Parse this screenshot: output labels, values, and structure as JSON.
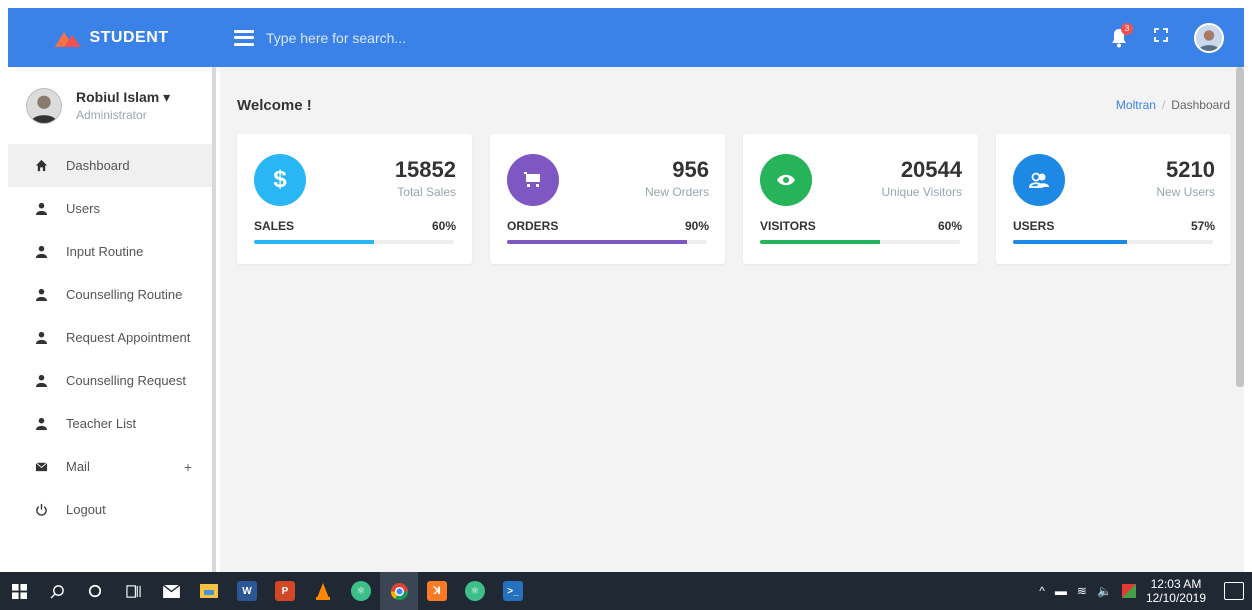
{
  "brand": {
    "name": "STUDENT"
  },
  "search": {
    "placeholder": "Type here for search..."
  },
  "topbar": {
    "notification_count": "3"
  },
  "user": {
    "name": "Robiul Islam",
    "caret": "▾",
    "role": "Administrator"
  },
  "sidebar": {
    "items": [
      {
        "label": "Dashboard",
        "icon": "home-icon"
      },
      {
        "label": "Users",
        "icon": "user-icon"
      },
      {
        "label": "Input Routine",
        "icon": "user-icon"
      },
      {
        "label": "Counselling Routine",
        "icon": "user-icon"
      },
      {
        "label": "Request Appointment",
        "icon": "user-icon"
      },
      {
        "label": "Counselling Request",
        "icon": "user-icon"
      },
      {
        "label": "Teacher List",
        "icon": "user-icon"
      },
      {
        "label": "Mail",
        "icon": "envelope-icon",
        "extra": "+"
      },
      {
        "label": "Logout",
        "icon": "power-icon"
      }
    ]
  },
  "page": {
    "title": "Welcome !"
  },
  "breadcrumb": {
    "root": "Moltran",
    "separator": "/",
    "current": "Dashboard"
  },
  "cards": [
    {
      "value": "15852",
      "subtitle": "Total Sales",
      "label": "SALES",
      "percent": "60%",
      "progress": 60,
      "color": "#29b6f6",
      "icon": "dollar-icon"
    },
    {
      "value": "956",
      "subtitle": "New Orders",
      "label": "ORDERS",
      "percent": "90%",
      "progress": 90,
      "color": "#7e57c2",
      "icon": "cart-icon"
    },
    {
      "value": "20544",
      "subtitle": "Unique Visitors",
      "label": "VISITORS",
      "percent": "60%",
      "progress": 60,
      "color": "#26b35a",
      "icon": "eye-icon"
    },
    {
      "value": "5210",
      "subtitle": "New Users",
      "label": "USERS",
      "percent": "57%",
      "progress": 57,
      "color": "#1e88e5",
      "icon": "users-icon"
    }
  ],
  "taskbar": {
    "time": "12:03 AM",
    "date": "12/10/2019",
    "apps": [
      "start-icon",
      "search-icon",
      "cortana-icon",
      "task-view-icon",
      "mail-icon",
      "file-explorer-icon",
      "word-icon",
      "powerpoint-icon",
      "vlc-icon",
      "atom-icon",
      "chrome-icon",
      "xampp-icon",
      "atom-icon",
      "powershell-icon"
    ]
  },
  "colors": {
    "topbar": "#3b82e8",
    "taskbar": "#1f2833",
    "content_bg": "#f3f3f3"
  }
}
